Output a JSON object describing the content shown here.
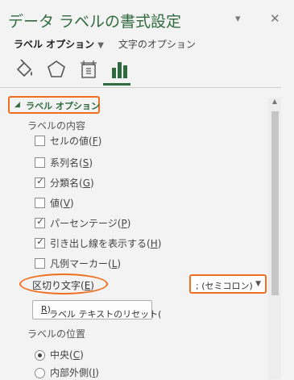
{
  "panel": {
    "title": "データ ラベルの書式設定",
    "pin_icon": "chevron-down-icon",
    "close_label": "✕"
  },
  "tabs": {
    "label_options": "ラベル オプション",
    "text_options": "文字のオプション"
  },
  "icon_tabs": [
    "fill-line-icon",
    "effects-icon",
    "size-properties-icon",
    "label-options-icon"
  ],
  "section": {
    "title": "ラベル オプション",
    "contents_label": "ラベルの内容",
    "checkboxes": [
      {
        "label": "セルの値(",
        "key": "F",
        "checked": false
      },
      {
        "label": "系列名(",
        "key": "S",
        "checked": false
      },
      {
        "label": "分類名(",
        "key": "G",
        "checked": true
      },
      {
        "label": "値(",
        "key": "V",
        "checked": false
      },
      {
        "label": "パーセンテージ(",
        "key": "P",
        "checked": true
      },
      {
        "label": "引き出し線を表示する(",
        "key": "H",
        "checked": true
      },
      {
        "label": "凡例マーカー(",
        "key": "L",
        "checked": false
      }
    ],
    "separator": {
      "label": "区切り文字(",
      "key": "E",
      "value": "; (セミコロン)"
    },
    "reset_button": {
      "label": "ラベル テキストのリセット(",
      "key": "R"
    },
    "position_label": "ラベルの位置",
    "radios": [
      {
        "label": "中央(",
        "key": "C",
        "selected": true
      },
      {
        "label": "内部外側(",
        "key": "I",
        "selected": false
      }
    ]
  },
  "colors": {
    "accent": "#2f6b3e",
    "highlight": "#ee6f1f"
  }
}
